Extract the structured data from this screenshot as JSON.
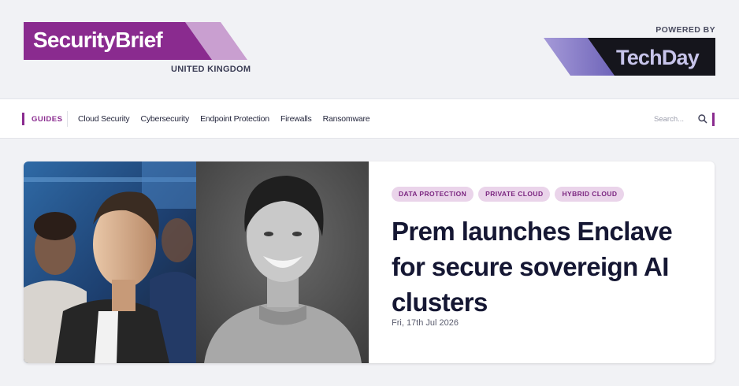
{
  "header": {
    "brand": {
      "name": "SecurityBrief",
      "region": "UNITED KINGDOM"
    },
    "partner": {
      "powered_by": "POWERED BY",
      "name": "TechDay"
    }
  },
  "nav": {
    "guides_label": "GUIDES",
    "links": [
      "Cloud Security",
      "Cybersecurity",
      "Endpoint Protection",
      "Firewalls",
      "Ransomware"
    ],
    "search_placeholder": "Search..."
  },
  "feature": {
    "tags": [
      "DATA PROTECTION",
      "PRIVATE CLOUD",
      "HYBRID CLOUD"
    ],
    "headline": "Prem launches Enclave for secure sovereign AI clusters",
    "date": "Fri, 17th Jul 2026"
  },
  "colors": {
    "accent": "#8a2b8f",
    "tag_bg": "#ead4ea",
    "background": "#f1f2f5",
    "techday_bg": "#15151c"
  },
  "icons": {
    "search": "search-icon"
  }
}
